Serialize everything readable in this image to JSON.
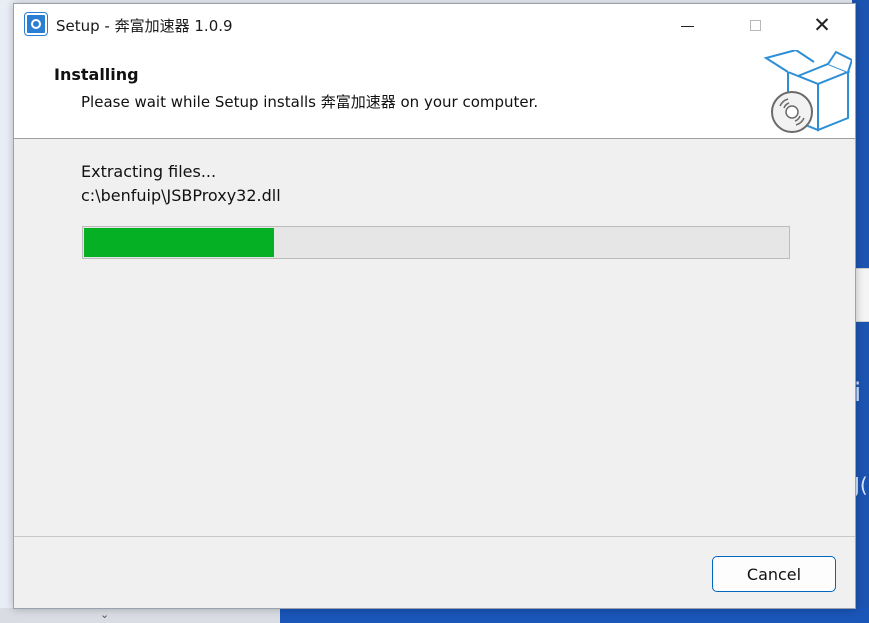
{
  "window": {
    "title": "Setup - 奔富加速器 1.0.9",
    "controls": {
      "minimize_icon": "minimize-icon",
      "maximize_icon": "maximize-icon",
      "close_icon": "close-icon"
    }
  },
  "header": {
    "title": "Installing",
    "subtitle": "Please wait while Setup installs 奔富加速器 on your computer.",
    "graphic": "install-box-icon"
  },
  "status": {
    "label": "Extracting files...",
    "current_file": "c:\\benfuip\\JSBProxy32.dll"
  },
  "progress": {
    "fraction": 0.27,
    "color": "#06b025"
  },
  "footer": {
    "cancel_label": "Cancel",
    "accent": "#0067c0"
  }
}
